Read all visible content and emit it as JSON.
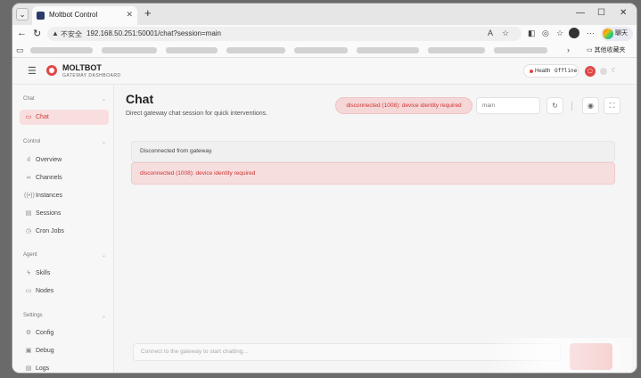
{
  "browser": {
    "tab_title": "Moltbot Control",
    "tab_close": "✕",
    "new_tab": "+",
    "url_warning": "不安全",
    "url": "192.168.50.251:50001/chat?session=main",
    "chat_button": "聊天",
    "other_bookmarks": "其他收藏夹",
    "window": {
      "minimize": "—",
      "maximize": "☐",
      "close": "✕"
    }
  },
  "app": {
    "brand": "MOLTBOT",
    "brand_sub": "GATEWAY DASHBOARD",
    "health_label": "Health",
    "health_value": "Offline"
  },
  "sidebar": {
    "groups": [
      {
        "label": "Chat",
        "items": [
          {
            "label": "Chat",
            "active": true
          }
        ]
      },
      {
        "label": "Control",
        "items": [
          {
            "label": "Overview"
          },
          {
            "label": "Channels"
          },
          {
            "label": "Instances"
          },
          {
            "label": "Sessions"
          },
          {
            "label": "Cron Jobs"
          }
        ]
      },
      {
        "label": "Agent",
        "items": [
          {
            "label": "Skills"
          },
          {
            "label": "Nodes"
          }
        ]
      },
      {
        "label": "Settings",
        "items": [
          {
            "label": "Config"
          },
          {
            "label": "Debug"
          },
          {
            "label": "Logs"
          }
        ]
      }
    ]
  },
  "main": {
    "title": "Chat",
    "subtitle": "Direct gateway chat session for quick interventions.",
    "error_pill": "disconnected (1008): device identity required",
    "session_value": "main",
    "info_message": "Disconnected from gateway.",
    "error_message": "disconnected (1008): device identity required",
    "composer_placeholder": "Connect to the gateway to start chatting…"
  },
  "colors": {
    "accent": "#e04848",
    "error_bg": "#f7dede",
    "error_text": "#cc3333"
  }
}
